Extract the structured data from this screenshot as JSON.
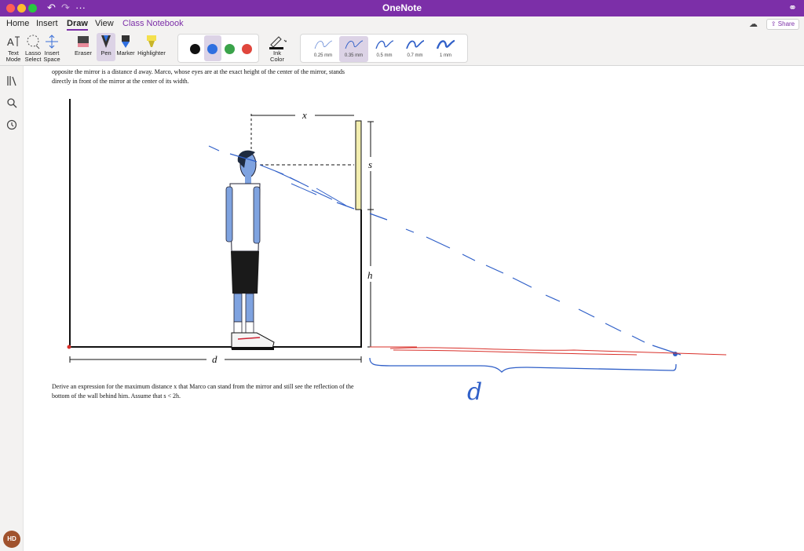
{
  "window": {
    "title": "OneNote"
  },
  "tabs": [
    "Home",
    "Insert",
    "Draw",
    "View",
    "Class Notebook"
  ],
  "share_label": "Share",
  "ribbon": {
    "text_mode_1": "Text",
    "text_mode_2": "Mode",
    "lasso_1": "Lasso",
    "lasso_2": "Select",
    "insert_space_1": "Insert",
    "insert_space_2": "Space",
    "eraser": "Eraser",
    "pen": "Pen",
    "marker": "Marker",
    "highlighter": "Highlighter",
    "ink_color_1": "Ink",
    "ink_color_2": "Color",
    "colors": [
      "#111111",
      "#2f6fe0",
      "#3aa34a",
      "#e0463c"
    ],
    "pen_sizes": [
      "0.25 mm",
      "0.35 mm",
      "0.5 mm",
      "0.7 mm",
      "1 mm"
    ]
  },
  "user": {
    "initials": "HD"
  },
  "page": {
    "text_top_1": "opposite the mirror is a distance d away. Marco, whose eyes are at the exact height of the center of the mirror, stands",
    "text_top_2": "directly in front of the mirror at the center of its width.",
    "label_x": "x",
    "label_s": "s",
    "label_h": "h",
    "label_d": "d",
    "question_1": "Derive an expression for the maximum distance x that Marco can stand from the mirror and still see the reflection of the",
    "question_2": "bottom of the wall behind him. Assume that s < 2h.",
    "handwritten_d": "d"
  },
  "colors": {
    "accent": "#7c2fa8",
    "ink_blue": "#2f5fc8",
    "ink_red": "#d9302a"
  }
}
